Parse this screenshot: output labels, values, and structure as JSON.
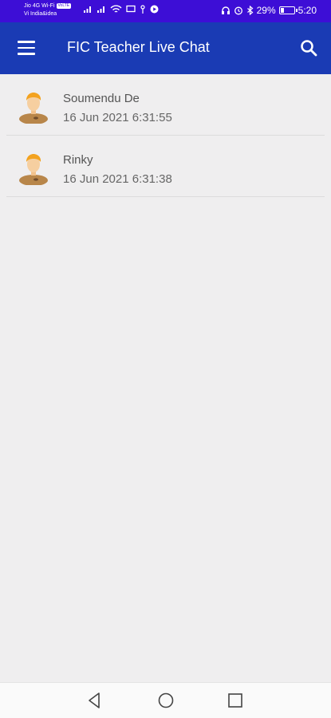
{
  "status_bar": {
    "carrier1": "Jio 4G Wi-Fi",
    "volte": "VoLTE",
    "carrier2": "Vi India&idea",
    "battery": "29%",
    "battery_fraction": 0.29,
    "time": "5:20"
  },
  "app_bar": {
    "title": "FIC Teacher Live Chat",
    "menu_icon": "menu-icon",
    "search_icon": "search-icon"
  },
  "chats": [
    {
      "name": "Soumendu De",
      "time": "16 Jun 2021 6:31:55"
    },
    {
      "name": "Rinky",
      "time": "16 Jun 2021 6:31:38"
    }
  ],
  "nav_bar": {
    "icons": [
      "back-icon",
      "home-icon",
      "recents-icon"
    ]
  },
  "colors": {
    "status_bar": "#3d0ed6",
    "app_bar": "#1a3bb4",
    "background": "#efeeef"
  }
}
